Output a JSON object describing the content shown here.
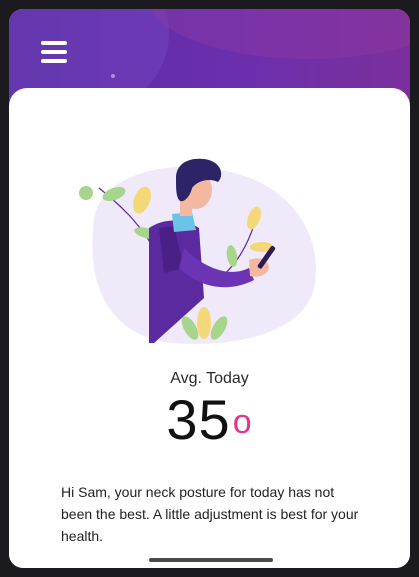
{
  "header": {
    "menu_icon": "hamburger-menu-icon",
    "colors": {
      "gradient_start": "#5a2aa0",
      "gradient_end": "#7b2f9c"
    }
  },
  "main": {
    "illustration_icon": "person-using-phone-illustration",
    "avg_label": "Avg. Today",
    "value": "35",
    "unit": "o",
    "unit_color": "#e0378d",
    "message": "Hi Sam, your neck posture for today has not been the best. A little adjustment is best for your health."
  }
}
